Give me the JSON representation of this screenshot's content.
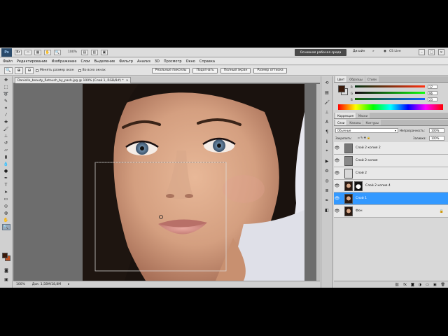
{
  "app": {
    "logo": "Ps",
    "zoom_display": "100%",
    "workspace_active": "Основная рабочая среда",
    "workspace_other": "Дизайн",
    "workspace_more": "»",
    "cs_live": "CS Live"
  },
  "menu": [
    "Файл",
    "Редактирование",
    "Изображение",
    "Слои",
    "Выделение",
    "Фильтр",
    "Анализ",
    "3D",
    "Просмотр",
    "Окно",
    "Справка"
  ],
  "options_bar": {
    "check1": "Менять размер окон",
    "check2": "Во всех окнах",
    "btn1": "Реальные пикселы",
    "btn2": "Подогнать",
    "btn3": "Полный экран",
    "btn4": "Размер оттиска"
  },
  "document": {
    "tab_title": "Danielle_beauty_Retouch_by_pash.jpg @ 100% (Слой 1, RGB/8#) *",
    "status_zoom": "100%",
    "status_doc": "Док: 1,58М/18,8М"
  },
  "color_panel": {
    "tabs": [
      "Цвет",
      "Образцы",
      "Стили"
    ],
    "r": "17",
    "g": "96",
    "b": "23"
  },
  "adjust_panel": {
    "tabs": [
      "Коррекция",
      "Маски"
    ]
  },
  "layers_panel": {
    "tabs": [
      "Слои",
      "Каналы",
      "Контуры"
    ],
    "blend_mode": "Обычные",
    "opacity_label": "Непрозрачность:",
    "opacity": "100%",
    "lock_label": "Закрепить:",
    "fill_label": "Заливка:",
    "fill": "100%",
    "layers": [
      {
        "name": "Слой 2 копия 2",
        "selected": false,
        "thumb": "gray"
      },
      {
        "name": "Слой 2 копия",
        "selected": false,
        "thumb": "gray"
      },
      {
        "name": "Слой 2",
        "selected": false,
        "thumb": "light"
      },
      {
        "name": "Слой 2 копия 4",
        "selected": false,
        "thumb": "portrait"
      },
      {
        "name": "Слой 1",
        "selected": true,
        "thumb": "portrait"
      },
      {
        "name": "Фон",
        "selected": false,
        "thumb": "portrait"
      }
    ]
  },
  "colors": {
    "accent": "#3399ff",
    "workspace_btn": "#4a4a4a",
    "foreground": "#3a1a0a",
    "background": "#c05020"
  },
  "icons": [
    "zoom-icon",
    "move-tool-icon",
    "marquee-tool-icon",
    "lasso-tool-icon",
    "brush-tool-icon",
    "eye-icon"
  ]
}
